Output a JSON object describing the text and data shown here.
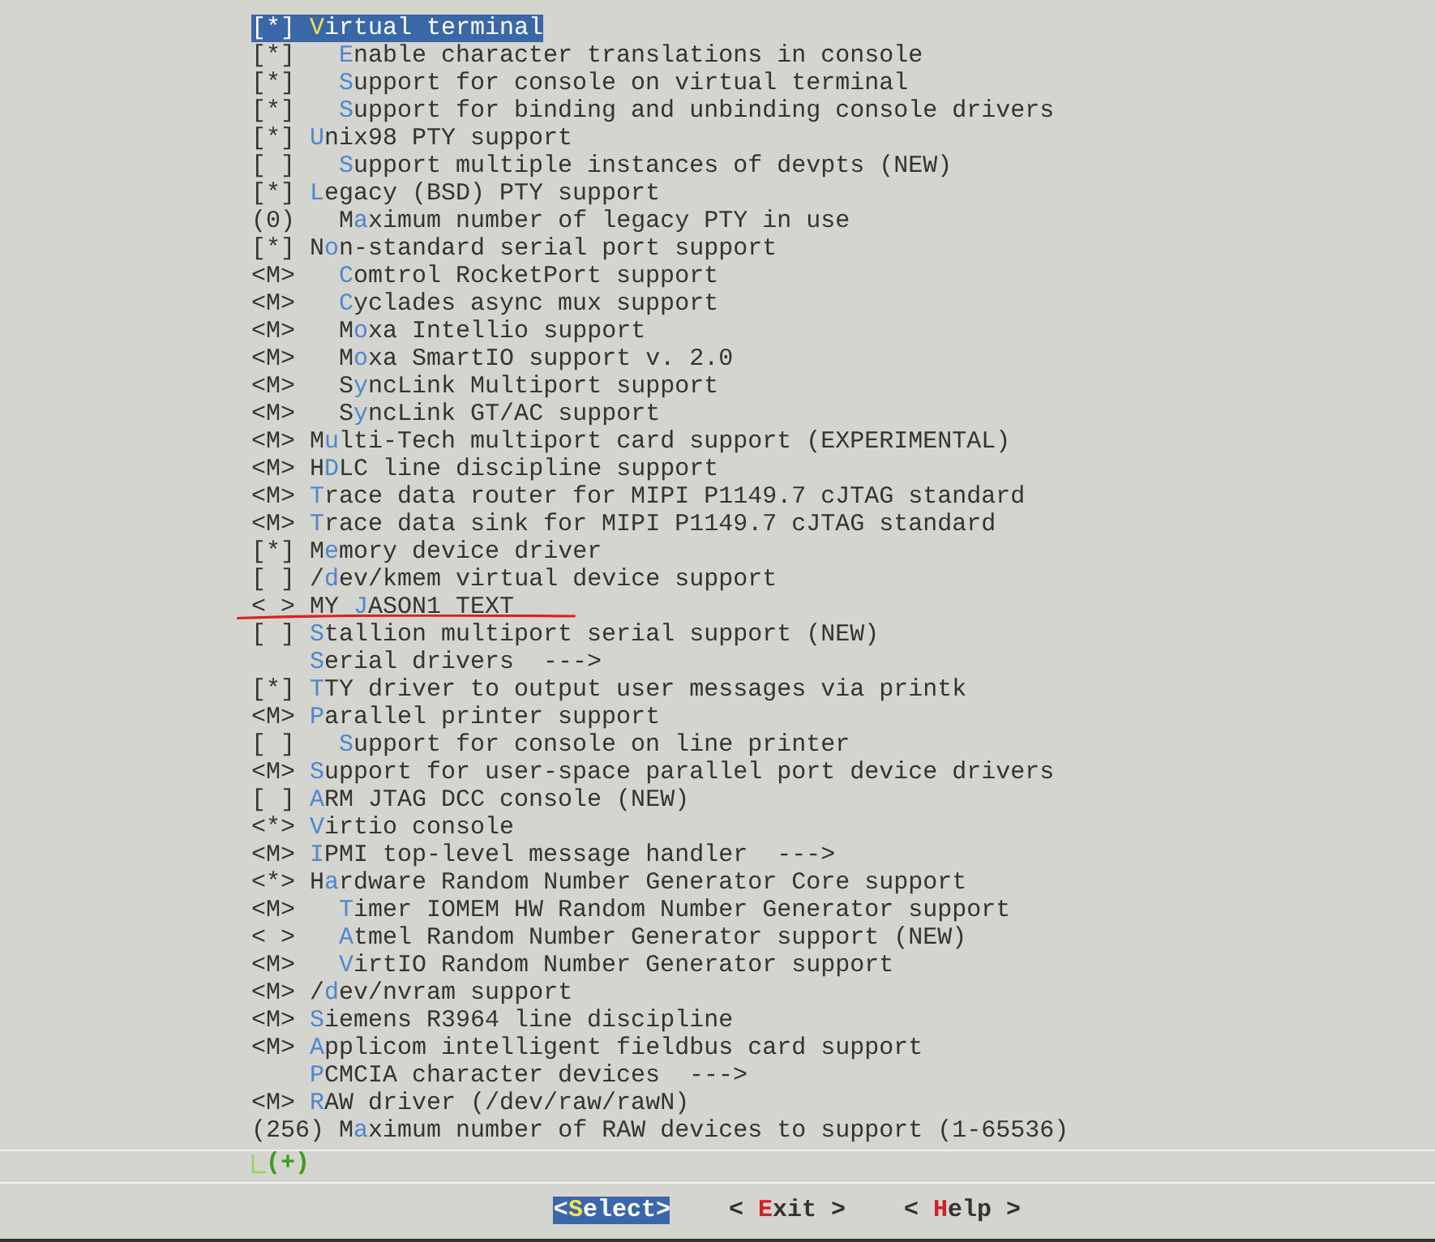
{
  "items": [
    {
      "prefix": "[*]",
      "label": "**V**irtual terminal",
      "selected": true,
      "children": [
        {
          "prefix": "[*]",
          "label": "**E**nable character translations in console",
          "selected": false
        },
        {
          "prefix": "[*]",
          "label": "**S**upport for console on virtual terminal",
          "selected": false
        },
        {
          "prefix": "[*]",
          "label": "**S**upport for binding and unbinding console drivers",
          "selected": false
        }
      ]
    },
    {
      "prefix": "[*]",
      "label": "**U**nix98 PTY support",
      "selected": false,
      "children": [
        {
          "prefix": "[ ]",
          "label": "**S**upport multiple instances of devpts (NEW)",
          "selected": false
        }
      ]
    },
    {
      "prefix": "[*]",
      "label": "**L**egacy (BSD) PTY support",
      "selected": false,
      "children": [
        {
          "prefix": "(0)",
          "label": "M**a**ximum number of legacy PTY in use",
          "selected": false
        }
      ]
    },
    {
      "prefix": "[*]",
      "label": "N**o**n-standard serial port support",
      "selected": false,
      "children": [
        {
          "prefix": "<M>",
          "label": "**C**omtrol RocketPort support",
          "selected": false
        },
        {
          "prefix": "<M>",
          "label": "**C**yclades async mux support",
          "selected": false
        },
        {
          "prefix": "<M>",
          "label": "M**o**xa Intellio support",
          "selected": false
        },
        {
          "prefix": "<M>",
          "label": "M**o**xa SmartIO support v. 2.0",
          "selected": false
        },
        {
          "prefix": "<M>",
          "label": "S**y**ncLink Multiport support",
          "selected": false
        },
        {
          "prefix": "<M>",
          "label": "S**y**ncLink GT/AC support",
          "selected": false
        }
      ]
    },
    {
      "prefix": "<M>",
      "label": "M**u**lti-Tech multiport card support (EXPERIMENTAL)",
      "selected": false
    },
    {
      "prefix": "<M>",
      "label": "H**D**LC line discipline support",
      "selected": false
    },
    {
      "prefix": "<M>",
      "label": "**T**race data router for MIPI P1149.7 cJTAG standard",
      "selected": false
    },
    {
      "prefix": "<M>",
      "label": "**T**race data sink for MIPI P1149.7 cJTAG standard",
      "selected": false
    },
    {
      "prefix": "[*]",
      "label": "M**e**mory device driver",
      "selected": false
    },
    {
      "prefix": "[ ]",
      "label": "/**d**ev/kmem virtual device support",
      "selected": false
    },
    {
      "prefix": "< >",
      "label": "MY **J**ASON1 TEXT",
      "selected": false,
      "underlined": true
    },
    {
      "prefix": "[ ]",
      "label": "**S**tallion multiport serial support (NEW)",
      "selected": false
    },
    {
      "label": "**S**erial drivers  --->",
      "selected": false
    },
    {
      "prefix": "[*]",
      "label": "**T**TY driver to output user messages via printk",
      "selected": false
    },
    {
      "prefix": "<M>",
      "label": "**P**arallel printer support",
      "selected": false,
      "children": [
        {
          "prefix": "[ ]",
          "label": "**S**upport for console on line printer",
          "selected": false
        }
      ]
    },
    {
      "prefix": "<M>",
      "label": "**S**upport for user-space parallel port device drivers",
      "selected": false
    },
    {
      "prefix": "[ ]",
      "label": "**A**RM JTAG DCC console (NEW)",
      "selected": false
    },
    {
      "prefix": "<*>",
      "label": "**V**irtio console",
      "selected": false
    },
    {
      "prefix": "<M>",
      "label": "**I**PMI top-level message handler  --->",
      "selected": false
    },
    {
      "prefix": "<*>",
      "label": "H**a**rdware Random Number Generator Core support",
      "selected": false,
      "children": [
        {
          "prefix": "<M>",
          "label": "**T**imer IOMEM HW Random Number Generator support",
          "selected": false
        },
        {
          "prefix": "< >",
          "label": "**A**tmel Random Number Generator support (NEW)",
          "selected": false
        },
        {
          "prefix": "<M>",
          "label": "**V**irtIO Random Number Generator support",
          "selected": false
        }
      ]
    },
    {
      "prefix": "<M>",
      "label": "/**d**ev/nvram support",
      "selected": false
    },
    {
      "prefix": "<M>",
      "label": "**S**iemens R3964 line discipline",
      "selected": false
    },
    {
      "prefix": "<M>",
      "label": "**A**pplicom intelligent fieldbus card support",
      "selected": false
    },
    {
      "label": "**P**CMCIA character devices  --->",
      "selected": false
    },
    {
      "prefix": "<M>",
      "label": "**R**AW driver (/dev/raw/rawN)",
      "selected": false
    },
    {
      "prefix": "(256)",
      "label": "M**a**ximum number of RAW devices to support (1-65536)",
      "selected": false
    }
  ],
  "more_indicator": "(+)",
  "buttons": [
    {
      "label": "<**S**elect>",
      "selected": true
    },
    {
      "label": "< **E**xit >",
      "selected": false
    },
    {
      "label": "< **H**elp >",
      "selected": false
    }
  ]
}
